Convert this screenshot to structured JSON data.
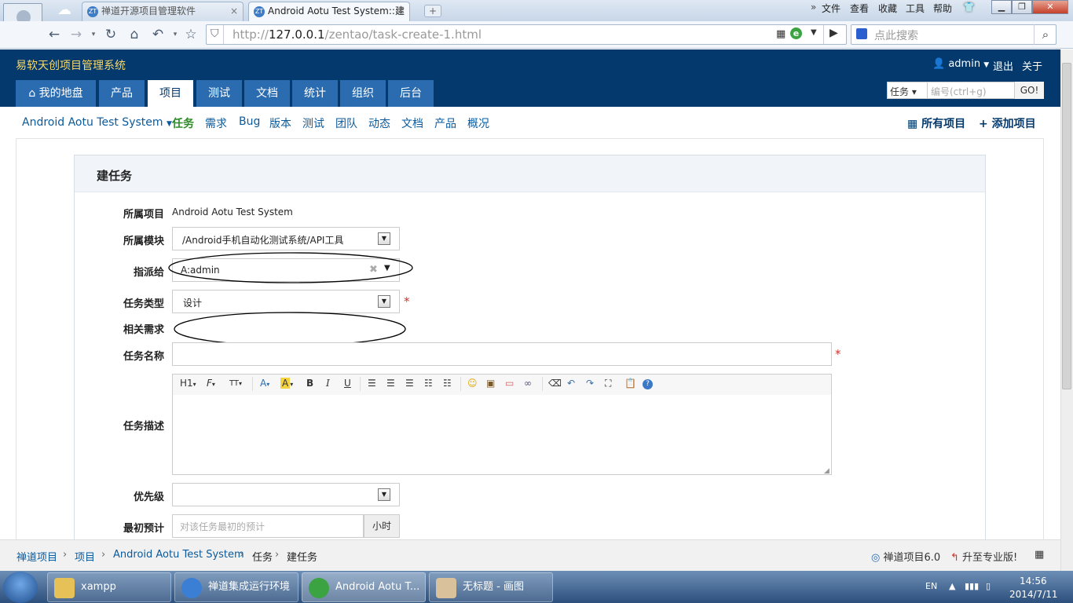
{
  "browser": {
    "tabs": [
      {
        "label": "禅道开源项目管理软件",
        "favicon": "ZT"
      },
      {
        "label": "Android Aotu Test System::建",
        "favicon": "ZT"
      }
    ],
    "menu": [
      "文件",
      "查看",
      "收藏",
      "工具",
      "帮助"
    ],
    "url_prefix": "http://",
    "url_host": "127.0.0.1",
    "url_path": "/zentao/task-create-1.html",
    "search_placeholder": "点此搜索"
  },
  "app": {
    "title": "易软天创项目管理系统",
    "user": "admin",
    "logout": "退出",
    "about": "关于",
    "main_nav": [
      "我的地盘",
      "产品",
      "项目",
      "测试",
      "文档",
      "统计",
      "组织",
      "后台"
    ],
    "quick_type": "任务",
    "quick_placeholder": "编号(ctrl+g)",
    "quick_go": "GO!",
    "project_name": "Android Aotu Test System",
    "sub_nav": [
      "任务",
      "需求",
      "Bug",
      "版本",
      "测试",
      "团队",
      "动态",
      "文档",
      "产品",
      "概况"
    ],
    "all_projects": "所有项目",
    "add_project": "添加项目"
  },
  "form": {
    "title": "建任务",
    "project_label": "所属项目",
    "project_value": "Android Aotu Test System",
    "module_label": "所属模块",
    "module_value": "/Android手机自动化测试系统/API工具",
    "assign_label": "指派给",
    "assign_value": "A:admin",
    "type_label": "任务类型",
    "type_value": "设计",
    "story_label": "相关需求",
    "name_label": "任务名称",
    "desc_label": "任务描述",
    "pri_label": "优先级",
    "estimate_label": "最初预计",
    "estimate_placeholder": "对该任务最初的预计",
    "estimate_unit": "小时",
    "required_mark": "*",
    "toolbar": [
      "H1",
      "F",
      "TT",
      "A",
      "A",
      "B",
      "I",
      "U"
    ]
  },
  "footer": {
    "crumbs": [
      "禅道项目",
      "项目",
      "Android Aotu Test System",
      "任务",
      "建任务"
    ],
    "version": "禅道项目6.0",
    "upgrade": "升至专业版!"
  },
  "taskbar": {
    "items": [
      "xampp",
      "禅道集成运行环境",
      "Android Aotu T...",
      "无标题 - 画图"
    ],
    "lang": "EN",
    "time": "14:56",
    "date": "2014/7/11"
  }
}
